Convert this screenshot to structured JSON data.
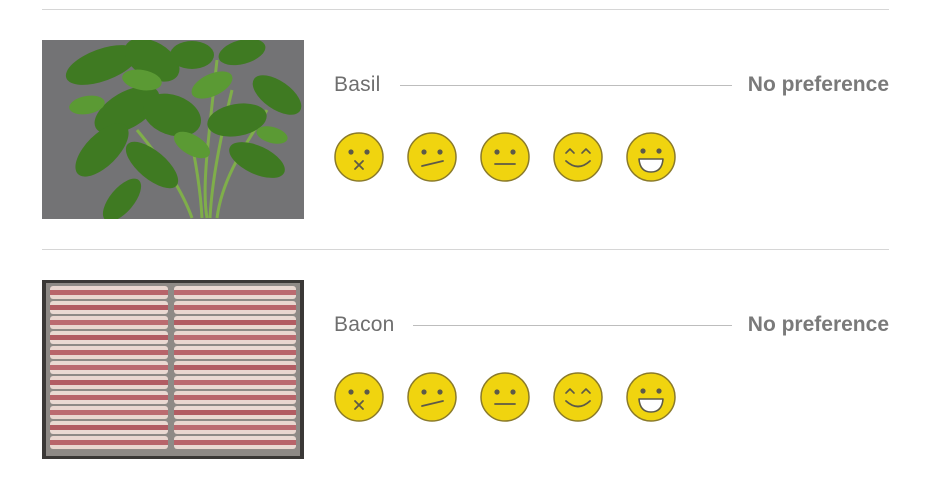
{
  "items": [
    {
      "name": "Basil",
      "preference": "No preference",
      "photo_icon": "basil-photo",
      "rating_options": [
        "dislike",
        "slightly-dislike",
        "neutral",
        "like",
        "love"
      ]
    },
    {
      "name": "Bacon",
      "preference": "No preference",
      "photo_icon": "bacon-photo",
      "rating_options": [
        "dislike",
        "slightly-dislike",
        "neutral",
        "like",
        "love"
      ]
    }
  ],
  "colors": {
    "face_fill": "#f0d40f",
    "face_stroke": "#8a7a2a",
    "label": "#6f6f6f",
    "preference": "#7a7a7a",
    "divider": "#d6d6d6"
  }
}
